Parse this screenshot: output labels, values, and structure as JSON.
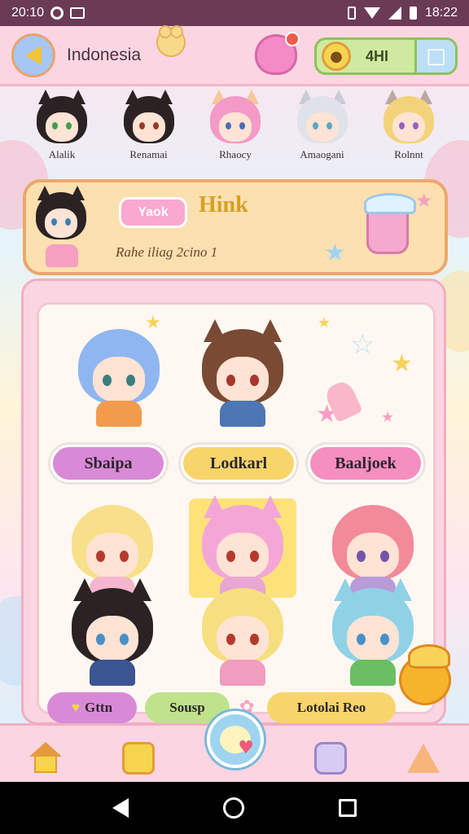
{
  "status_bar": {
    "time_left": "20:10",
    "time_right": "18:22"
  },
  "header": {
    "title": "Indonesia",
    "coins": "4HI"
  },
  "avatars": [
    {
      "name": "Alalik",
      "hair": "#2b2224",
      "ear": "#2b2224",
      "eye": "#3e9f52"
    },
    {
      "name": "Renamai",
      "hair": "#2b2224",
      "ear": "#2b2224",
      "eye": "#9a3a28"
    },
    {
      "name": "Rhaocy",
      "hair": "#f49ac6",
      "ear": "#f7c79a",
      "eye": "#4a6cb8"
    },
    {
      "name": "Amaogani",
      "hair": "#e0e2ea",
      "ear": "#c9cbd6",
      "eye": "#5aa6c8"
    },
    {
      "name": "Rolnnt",
      "hair": "#f3d37a",
      "ear": "#bda8a0",
      "eye": "#9b5fc0"
    }
  ],
  "profile": {
    "bubble": "Yaok",
    "title": "Hink",
    "subtitle": "Rahe iliag 2cino 1"
  },
  "characters": {
    "row1": [
      {
        "hair": "#8fb6f0",
        "eye": "#3c7e7f",
        "body": "#f29b4d"
      },
      {
        "hair": "#7a4a33",
        "eye": "#a7362e",
        "body": "#4d76b5"
      }
    ],
    "row2": [
      {
        "hair": "#f8e08a",
        "eye": "#b6392d",
        "body": "#f7b6cf"
      },
      {
        "hair": "#f4a7d6",
        "eye": "#b6392d",
        "body": "#e7a7d0"
      },
      {
        "hair": "#f28a9a",
        "eye": "#7355a8",
        "body": "#b89bd9"
      }
    ],
    "row3": [
      {
        "hair": "#2b2224",
        "eye": "#4a8fc8",
        "body": "#3b5591"
      },
      {
        "hair": "#f6df80",
        "eye": "#b6392d",
        "body": "#f09dc0"
      },
      {
        "hair": "#8fd2e6",
        "eye": "#4a8fc8",
        "body": "#6cbe63"
      }
    ]
  },
  "buttons": {
    "b1": "Sbaipa",
    "b2": "Lodkarl",
    "b3": "Baaljoek",
    "bottom1": "Gttn",
    "bottom2": "Sousp",
    "bottom3": "Lotolai Reo"
  },
  "colors": {
    "purple_pill": "#d98ad6",
    "yellow_pill": "#f8d56a",
    "pink_pill": "#f58fbf",
    "green_pill": "#bfe38a"
  }
}
